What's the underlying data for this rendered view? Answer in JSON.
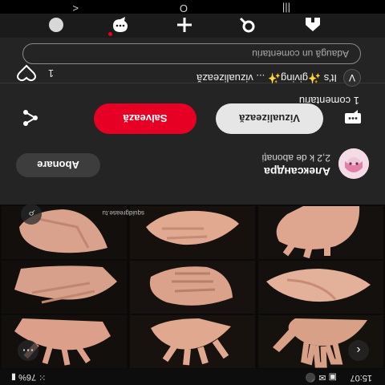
{
  "status_bar": {
    "time": "15:07",
    "status_icons": "▣ ✉ ⚫",
    "right_status": "⁙ 76% ▮"
  },
  "collage": {
    "watermark": "squidgrease.tu",
    "lens_icon": "lens-icon",
    "more_icon": "more-icon",
    "back_icon": "back-icon"
  },
  "pin": {
    "author_name": "Александра",
    "author_followers": "2,2 k de abonați",
    "follow_label": "Abonare",
    "visit_label": "Vizualizează",
    "save_label": "Salvează",
    "like_count": "1",
    "comments_title": "1 comentariu",
    "comment_avatar_letter": "V",
    "comment_text": "It's ✨giving✨ ... vizualizează",
    "comment_placeholder": "Adaugă un comentariu"
  },
  "nav": {
    "items": [
      "home-icon",
      "search-icon",
      "create-icon",
      "messages-icon",
      "profile-icon"
    ]
  },
  "system_nav": {
    "recent": "|||",
    "home": "O",
    "back": "<"
  },
  "colors": {
    "save_red": "#e60023",
    "sheet_bg": "#242424",
    "visit_bg": "#e6e6e6"
  }
}
